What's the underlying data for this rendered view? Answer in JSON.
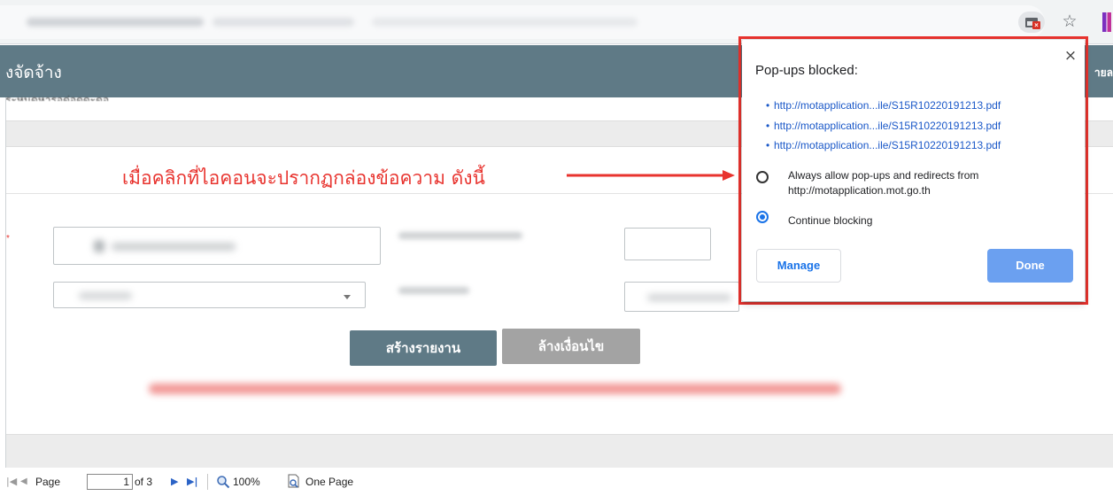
{
  "browser": {
    "popup_icon": "popup-blocked-icon",
    "star_icon": "bookmark-star-icon",
    "star_glyph": "☆",
    "extension_icon": "extension-icon"
  },
  "app": {
    "title": "งจัดจ้าง",
    "title_right": "ายล",
    "subtitle_partial": "ระหนดหารอด่อดดะดอ"
  },
  "annotation": {
    "text": "เมื่อคลิกที่ไอคอนจะปรากฏกล่องข้อความ ดังนี้",
    "color": "#e8332e"
  },
  "form": {
    "create_report_label": "สร้างรายงาน",
    "clear_conditions_label": "ล้างเงื่อนไข"
  },
  "toolbar": {
    "first_glyph": "|◀",
    "prev_glyph": "◀",
    "page_label": "Page",
    "page_value": "1",
    "of_text": "of 3",
    "next_glyph": "▶",
    "last_glyph": "▶|",
    "zoom_text": "100%",
    "one_page_label": "One Page"
  },
  "popup": {
    "title": "Pop-ups blocked:",
    "close_glyph": "×",
    "links": [
      "http://motapplication...ile/S15R10220191213.pdf",
      "http://motapplication...ile/S15R10220191213.pdf",
      "http://motapplication...ile/S15R10220191213.pdf"
    ],
    "bullet": "•",
    "option_allow": "Always allow pop-ups and redirects from http://motapplication.mot.go.th",
    "option_block": "Continue blocking",
    "selected_option": "Continue blocking",
    "manage_label": "Manage",
    "done_label": "Done"
  },
  "colors": {
    "header_bg": "#5f7a86",
    "primary_button": "#5f7a86",
    "secondary_button": "#a3a3a3",
    "highlight_border": "#e8332e",
    "done_button": "#6ba0f0",
    "link": "#1a58c8"
  }
}
